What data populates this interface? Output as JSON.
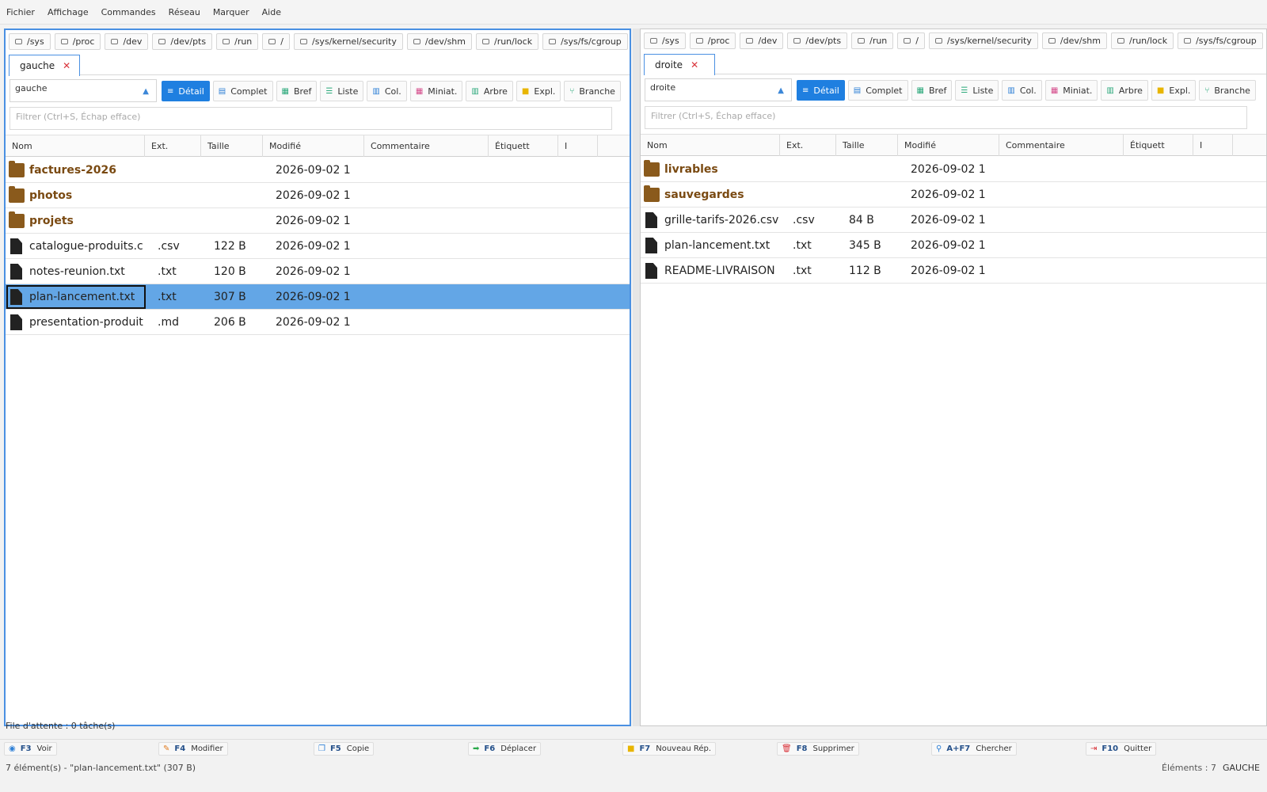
{
  "menu": [
    "Fichier",
    "Affichage",
    "Commandes",
    "Réseau",
    "Marquer",
    "Aide"
  ],
  "drives": [
    "/sys",
    "/proc",
    "/dev",
    "/dev/pts",
    "/run",
    "/",
    "/sys/kernel/security",
    "/dev/shm",
    "/run/lock",
    "/sys/fs/cgroup"
  ],
  "views": [
    {
      "label": "Détail",
      "icon": "≡",
      "color": "#ffffff"
    },
    {
      "label": "Complet",
      "icon": "▤",
      "color": "#2f80d6"
    },
    {
      "label": "Bref",
      "icon": "▦",
      "color": "#2aa87a"
    },
    {
      "label": "Liste",
      "icon": "☰",
      "color": "#2aa87a"
    },
    {
      "label": "Col.",
      "icon": "▥",
      "color": "#2f80d6"
    },
    {
      "label": "Miniat.",
      "icon": "▦",
      "color": "#d44a8a"
    },
    {
      "label": "Arbre",
      "icon": "▥",
      "color": "#2aa87a"
    },
    {
      "label": "Expl.",
      "icon": "■",
      "color": "#e8b500"
    },
    {
      "label": "Branche",
      "icon": "⑂",
      "color": "#2aa87a"
    }
  ],
  "filter_placeholder": "Filtrer (Ctrl+S, Échap efface)",
  "columns": [
    "Nom",
    "Ext.",
    "Taille",
    "Modifié",
    "Commentaire",
    "Étiquett",
    "I"
  ],
  "left": {
    "tab": "gauche",
    "path": "gauche",
    "rows": [
      {
        "type": "folder",
        "name": "factures-2026",
        "ext": "",
        "size": "",
        "date": "2026-09-02 1"
      },
      {
        "type": "folder",
        "name": "photos",
        "ext": "",
        "size": "",
        "date": "2026-09-02 1"
      },
      {
        "type": "folder",
        "name": "projets",
        "ext": "",
        "size": "",
        "date": "2026-09-02 1"
      },
      {
        "type": "file",
        "name": "catalogue-produits.c",
        "ext": ".csv",
        "size": "122 B",
        "date": "2026-09-02 1"
      },
      {
        "type": "file",
        "name": "notes-reunion.txt",
        "ext": ".txt",
        "size": "120 B",
        "date": "2026-09-02 1"
      },
      {
        "type": "file",
        "name": "plan-lancement.txt",
        "ext": ".txt",
        "size": "307 B",
        "date": "2026-09-02 1",
        "selected": true
      },
      {
        "type": "file",
        "name": "presentation-produit",
        "ext": ".md",
        "size": "206 B",
        "date": "2026-09-02 1"
      }
    ]
  },
  "right": {
    "tab": "droite",
    "path": "droite",
    "rows": [
      {
        "type": "folder",
        "name": "livrables",
        "ext": "",
        "size": "",
        "date": "2026-09-02 1"
      },
      {
        "type": "folder",
        "name": "sauvegardes",
        "ext": "",
        "size": "",
        "date": "2026-09-02 1"
      },
      {
        "type": "file",
        "name": "grille-tarifs-2026.csv",
        "ext": ".csv",
        "size": "84 B",
        "date": "2026-09-02 1"
      },
      {
        "type": "file",
        "name": "plan-lancement.txt",
        "ext": ".txt",
        "size": "345 B",
        "date": "2026-09-02 1"
      },
      {
        "type": "file",
        "name": "README-LIVRAISON",
        "ext": ".txt",
        "size": "112 B",
        "date": "2026-09-02 1"
      }
    ]
  },
  "queue": "File d'attente : 0 tâche(s)",
  "fkeys": [
    {
      "key": "F3",
      "label": "Voir",
      "icon": "◉",
      "color": "#2f80d6"
    },
    {
      "key": "F4",
      "label": "Modifier",
      "icon": "✎",
      "color": "#e07a1f"
    },
    {
      "key": "F5",
      "label": "Copie",
      "icon": "❐",
      "color": "#2f80d6"
    },
    {
      "key": "F6",
      "label": "Déplacer",
      "icon": "➡",
      "color": "#2aa84a"
    },
    {
      "key": "F7",
      "label": "Nouveau Rép.",
      "icon": "■",
      "color": "#e8b500"
    },
    {
      "key": "F8",
      "label": "Supprimer",
      "icon": "🗑",
      "color": "#d9343b"
    },
    {
      "key": "A+F7",
      "label": "Chercher",
      "icon": "⚲",
      "color": "#2f80d6"
    },
    {
      "key": "F10",
      "label": "Quitter",
      "icon": "⇥",
      "color": "#d9343b"
    }
  ],
  "status": {
    "selection": "7 élément(s)   -   \"plan-lancement.txt\" (307 B)",
    "count": "Éléments : 7",
    "side": "GAUCHE"
  }
}
